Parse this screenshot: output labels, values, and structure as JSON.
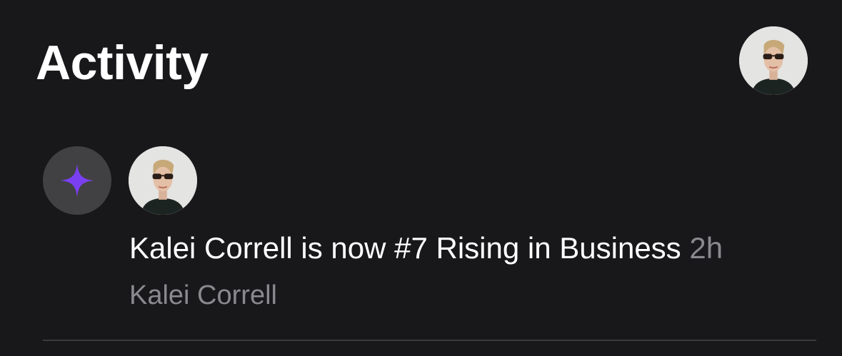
{
  "header": {
    "title": "Activity",
    "profile_avatar_icon": "user-photo-avatar"
  },
  "activity": {
    "badge_icon": "sparkle-icon",
    "badge_color": "#7b3ff2",
    "message": "Kalei Correll is now #7 Rising in Business",
    "time": "2h",
    "actor_name": "Kalei Correll"
  },
  "colors": {
    "background": "#18181b",
    "text_primary": "#ffffff",
    "text_secondary": "#8a8a8e",
    "badge_bg": "#414144",
    "divider": "#3a3a3c"
  }
}
